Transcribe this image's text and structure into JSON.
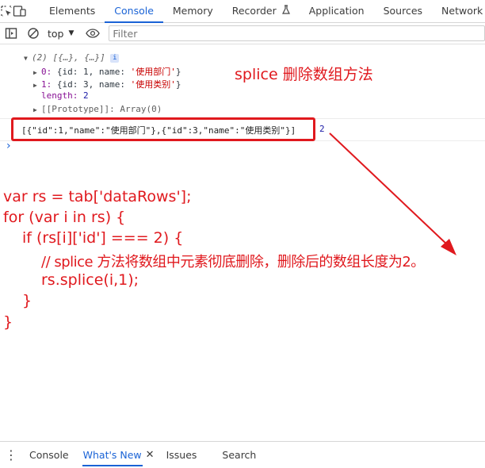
{
  "tabs": [
    {
      "label": "Elements"
    },
    {
      "label": "Console"
    },
    {
      "label": "Memory"
    },
    {
      "label": "Recorder"
    },
    {
      "label": "Application"
    },
    {
      "label": "Sources"
    },
    {
      "label": "Network"
    }
  ],
  "toolbar": {
    "context": "top",
    "filter_placeholder": "Filter"
  },
  "console": {
    "array_header": "(2) [{…}, {…}]",
    "info_badge": "i",
    "item0_key": "0:",
    "item0_val": " {id: 1, name: ",
    "item0_str": "'使用部门'",
    "item0_end": "}",
    "item1_key": "1:",
    "item1_val": " {id: 3, name: ",
    "item1_str": "'使用类别'",
    "item1_end": "}",
    "length_key": "length:",
    "length_val": " 2",
    "proto": "[[Prototype]]: Array(0)",
    "json_output": "[{\"id\":1,\"name\":\"使用部门\"},{\"id\":3,\"name\":\"使用类别\"}]",
    "count": "2",
    "prompt": "›"
  },
  "annotation": "splice 删除数组方法",
  "code": [
    "var rs = tab['dataRows'];",
    "for (var i in rs) {",
    "if (rs[i]['id'] === 2) {",
    "// splice 方法将数组中元素彻底删除，删除后的数组长度为2。",
    "rs.splice(i,1);",
    "}",
    "}"
  ],
  "drawer": {
    "tabs": [
      {
        "label": "Console"
      },
      {
        "label": "What's New"
      },
      {
        "label": "Issues"
      },
      {
        "label": "Search"
      }
    ],
    "close": "✕"
  },
  "colors": {
    "accent": "#1a63d6",
    "annotation": "#e0191e"
  }
}
